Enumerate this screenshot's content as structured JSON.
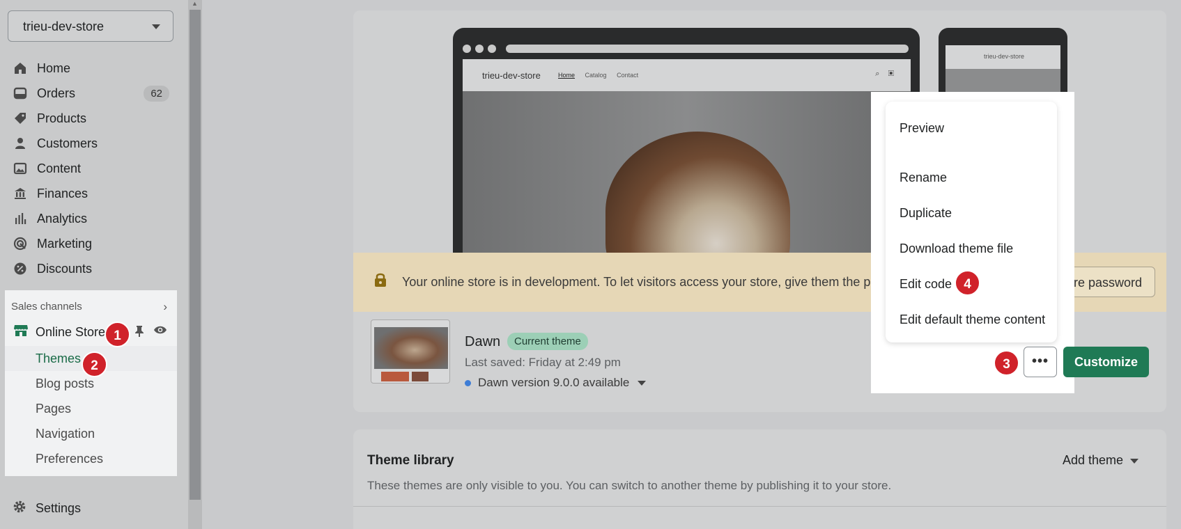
{
  "store_selector": {
    "name": "trieu-dev-store"
  },
  "nav": {
    "items": [
      {
        "label": "Home",
        "icon": "home-icon"
      },
      {
        "label": "Orders",
        "icon": "orders-icon",
        "badge": "62"
      },
      {
        "label": "Products",
        "icon": "tag-icon"
      },
      {
        "label": "Customers",
        "icon": "person-icon"
      },
      {
        "label": "Content",
        "icon": "content-icon"
      },
      {
        "label": "Finances",
        "icon": "bank-icon"
      },
      {
        "label": "Analytics",
        "icon": "bar-chart-icon"
      },
      {
        "label": "Marketing",
        "icon": "target-icon"
      },
      {
        "label": "Discounts",
        "icon": "discount-icon"
      }
    ],
    "sales_channels_label": "Sales channels",
    "online_store_label": "Online Store",
    "sub_items": [
      "Themes",
      "Blog posts",
      "Pages",
      "Navigation",
      "Preferences"
    ],
    "settings_label": "Settings"
  },
  "preview": {
    "site_name": "trieu-dev-store",
    "links": [
      "Home",
      "Catalog",
      "Contact"
    ],
    "phone_site_name": "trieu-dev-store"
  },
  "banner": {
    "message": "Your online store is in development. To let visitors access your store, give them the passwo",
    "button_label": "store password"
  },
  "current_theme": {
    "name": "Dawn",
    "badge": "Current theme",
    "last_saved": "Last saved: Friday at 2:49 pm",
    "version": "Dawn version 9.0.0 available",
    "more_label": "•••",
    "customize_label": "Customize"
  },
  "actions_menu": {
    "items": [
      "Preview",
      "Rename",
      "Duplicate",
      "Download theme file",
      "Edit code",
      "Edit default theme content"
    ]
  },
  "steps": [
    "1",
    "2",
    "3",
    "4"
  ],
  "theme_library": {
    "title": "Theme library",
    "description": "These themes are only visible to you. You can switch to another theme by publishing it to your store.",
    "add_theme_label": "Add theme"
  },
  "colors": {
    "accent_green": "#1f7a55",
    "step_red": "#d0222a",
    "badge_green": "#9ccfb6",
    "banner_bg": "#e6d7b6"
  }
}
